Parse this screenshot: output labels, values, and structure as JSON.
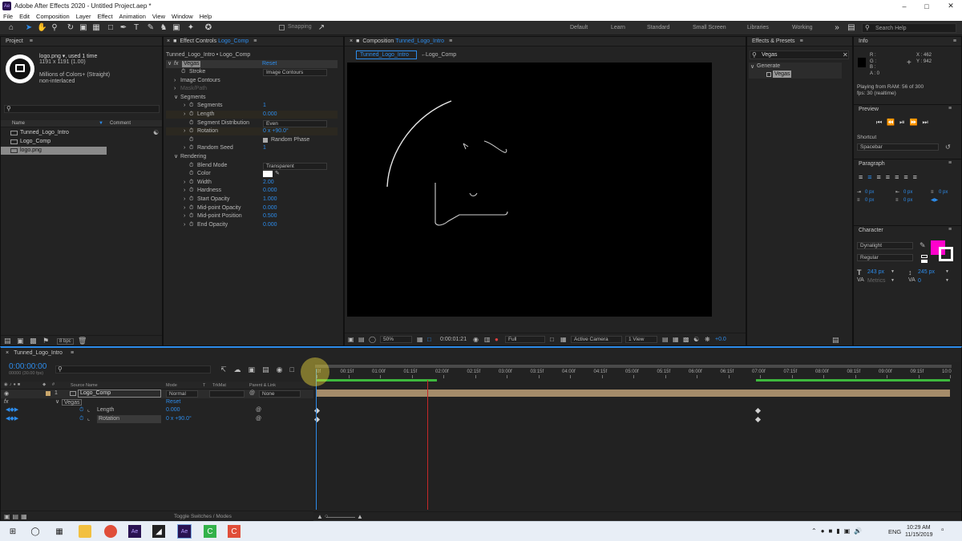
{
  "app": {
    "title": "Adobe After Effects 2020 - Untitled Project.aep *",
    "icon_text": "Ae",
    "menu": [
      "File",
      "Edit",
      "Composition",
      "Layer",
      "Effect",
      "Animation",
      "View",
      "Window",
      "Help"
    ],
    "window_buttons": [
      "minimize-icon",
      "maximize-icon",
      "close-icon"
    ]
  },
  "toolbar": {
    "snapping_label": "Snapping",
    "workspaces": [
      "Default",
      "Learn",
      "Standard",
      "Small Screen",
      "Libraries",
      "Working"
    ],
    "search_placeholder": "Search Help"
  },
  "project": {
    "title": "Project",
    "asset_name": "logo.png",
    "asset_used": ", used 1 time",
    "asset_size": "1191 x 1191 (1.00)",
    "asset_color": "Millions of Colors+ (Straight)",
    "asset_interlace": "non-interlaced",
    "col_name": "Name",
    "col_comment": "Comment",
    "items": [
      "Tunned_Logo_Intro",
      "Logo_Comp",
      "logo.png"
    ],
    "bpc": "8 bpc"
  },
  "effect_controls": {
    "title": "Effect Controls",
    "title_comp": "Logo_Comp",
    "subtitle": "Tunned_Logo_Intro • Logo_Comp",
    "effect_name": "Vegas",
    "reset_label": "Reset",
    "rows": [
      {
        "label": "Stroke",
        "value": "Image Contours",
        "type": "dropdown"
      },
      {
        "label": "Image Contours",
        "value": "",
        "type": "group"
      },
      {
        "label": "Mask/Path",
        "value": "",
        "type": "disabled"
      },
      {
        "label": "Segments",
        "value": "",
        "type": "section"
      },
      {
        "label": "Segments",
        "value": "1",
        "type": "number"
      },
      {
        "label": "Length",
        "value": "0.000",
        "type": "number"
      },
      {
        "label": "Segment Distribution",
        "value": "Even",
        "type": "dropdown"
      },
      {
        "label": "Rotation",
        "value": "0 x +90.0°",
        "type": "number"
      },
      {
        "label": "",
        "value": "Random Phase",
        "type": "checkbox"
      },
      {
        "label": "Random Seed",
        "value": "1",
        "type": "number"
      },
      {
        "label": "Rendering",
        "value": "",
        "type": "section"
      },
      {
        "label": "Blend Mode",
        "value": "Transparent",
        "type": "dropdown"
      },
      {
        "label": "Color",
        "value": "",
        "type": "color"
      },
      {
        "label": "Width",
        "value": "2.00",
        "type": "number"
      },
      {
        "label": "Hardness",
        "value": "0.000",
        "type": "number"
      },
      {
        "label": "Start Opacity",
        "value": "1.000",
        "type": "number"
      },
      {
        "label": "Mid-point Opacity",
        "value": "0.000",
        "type": "number"
      },
      {
        "label": "Mid-point Position",
        "value": "0.500",
        "type": "number"
      },
      {
        "label": "End Opacity",
        "value": "0.000",
        "type": "number"
      }
    ]
  },
  "composition": {
    "title": "Composition",
    "title_comp": "Tunned_Logo_Intro",
    "tabs": [
      "Tunned_Logo_Intro",
      "Logo_Comp"
    ],
    "zoom": "50%",
    "timecode": "0:00:01:21",
    "resolution": "Full",
    "camera": "Active Camera",
    "views": "1 View",
    "exposure": "+0.0"
  },
  "effects_presets": {
    "title": "Effects & Presets",
    "search_value": "Vegas",
    "category": "Generate",
    "item": "Vegas"
  },
  "info": {
    "title": "Info",
    "channels": [
      "R :",
      "G :",
      "B :",
      "A : 0"
    ],
    "x": "X : 462",
    "y": "Y : 942",
    "playing": "Playing from RAM: 56 of 300",
    "fps": "fps: 30 (realtime)"
  },
  "preview": {
    "title": "Preview",
    "shortcut_label": "Shortcut",
    "shortcut_value": "Spacebar"
  },
  "paragraph": {
    "title": "Paragraph",
    "values": [
      "0 px",
      "0 px",
      "0 px",
      "0 px",
      "0 px"
    ]
  },
  "character": {
    "title": "Character",
    "font": "Dynalight",
    "style": "Regular",
    "size": "243 px",
    "leading": "245 px",
    "kerning": "Metrics",
    "tracking": "0",
    "fill_color": "#ff00cc"
  },
  "timeline": {
    "tab": "Tunned_Logo_Intro",
    "timecode": "0:00:00:00",
    "fps_label": "00000 (30.00 fps)",
    "columns": [
      "Source Name",
      "Mode",
      "T",
      "TrkMat",
      "Parent & Link"
    ],
    "layer_num": "1",
    "layer_name": "Logo_Comp",
    "layer_mode": "Normal",
    "layer_parent": "None",
    "effect_name": "Vegas",
    "effect_reset": "Reset",
    "props": [
      {
        "name": "Length",
        "value": "0.000"
      },
      {
        "name": "Rotation",
        "value": "0 x +90.0°"
      }
    ],
    "ruler": [
      "0f",
      "00:15f",
      "01:00f",
      "01:15f",
      "02:00f",
      "02:15f",
      "03:00f",
      "03:15f",
      "04:00f",
      "04:15f",
      "05:00f",
      "05:15f",
      "06:00f",
      "06:15f",
      "07:00f",
      "07:15f",
      "08:00f",
      "08:15f",
      "09:00f",
      "09:15f",
      "10:0"
    ],
    "toggle_label": "Toggle Switches / Modes"
  },
  "taskbar": {
    "lang": "ENG",
    "time": "10:29 AM",
    "date": "11/15/2019"
  }
}
